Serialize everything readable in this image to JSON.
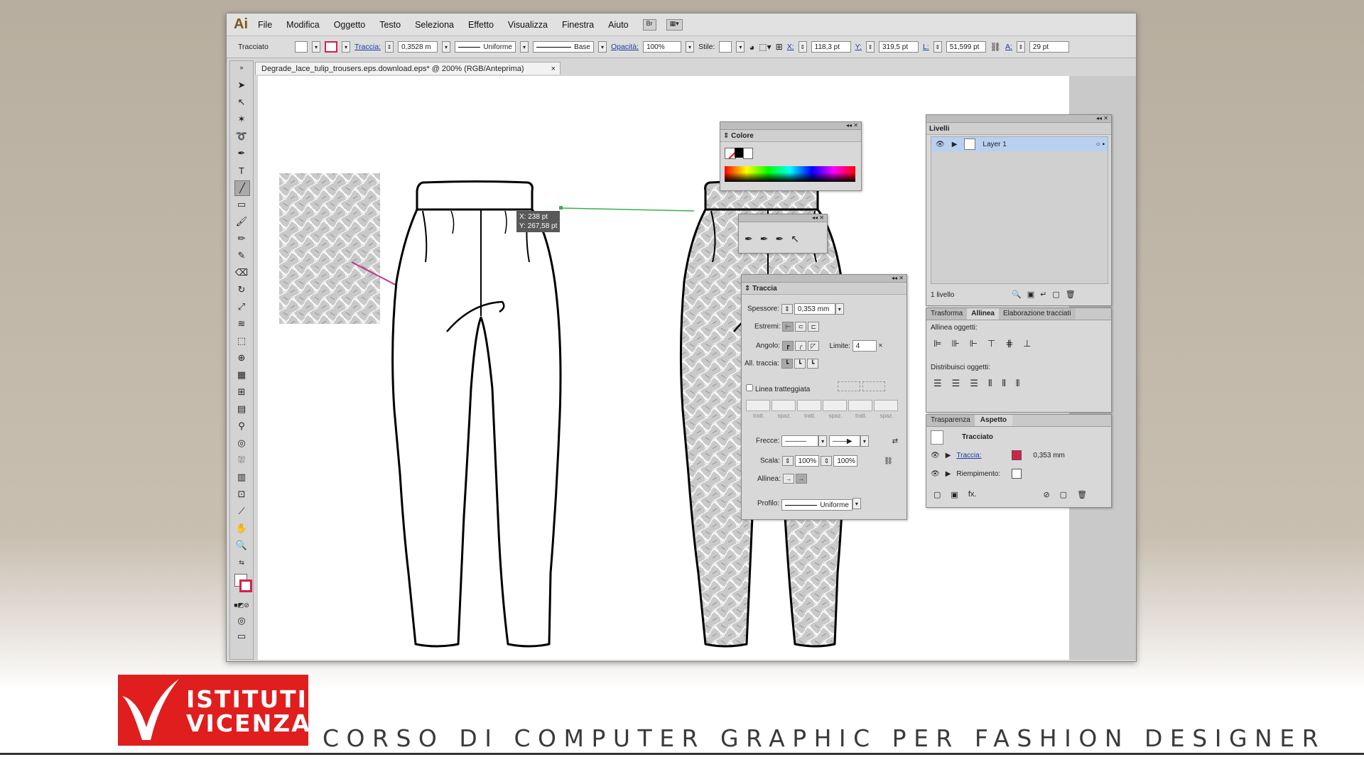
{
  "menubar": {
    "logo": "Ai",
    "items": [
      "File",
      "Modifica",
      "Oggetto",
      "Testo",
      "Seleziona",
      "Effetto",
      "Visualizza",
      "Finestra",
      "Aiuto"
    ],
    "bridge": "Br"
  },
  "control": {
    "mode": "Tracciato",
    "stroke_label": "Traccia:",
    "stroke_value": "0,3528 m",
    "profile": "Uniforme",
    "brush": "Base",
    "opacity_label": "Opacità:",
    "opacity_value": "100%",
    "style_label": "Stile:",
    "x_label": "X:",
    "x_value": "118,3 pt",
    "y_label": "Y:",
    "y_value": "319,5 pt",
    "w_label": "L:",
    "w_value": "51,599 pt",
    "h_label": "A:",
    "h_value": "29 pt"
  },
  "document": {
    "tab": "Degrade_lace_tulip_trousers.eps.download.eps* @ 200% (RGB/Anteprima)",
    "close": "×",
    "tooltip_x": "X: 238 pt",
    "tooltip_y": "Y: 267,58 pt"
  },
  "colore": {
    "title": "Colore"
  },
  "traccia": {
    "title": "Traccia",
    "spessore_label": "Spessore:",
    "spessore_value": "0,353 mm",
    "estremi_label": "Estremi:",
    "angolo_label": "Angolo:",
    "limite_label": "Limite:",
    "limite_value": "4",
    "allinea_traccia_label": "All. traccia:",
    "dashed_label": "Linea tratteggiata",
    "dash_labels": [
      "tratt.",
      "spaz.",
      "tratt.",
      "spaz.",
      "tratt.",
      "spaz."
    ],
    "frecce_label": "Frecce:",
    "scala_label": "Scala:",
    "scala_1": "100%",
    "scala_2": "100%",
    "allinea_label": "Allinea:",
    "profilo_label": "Profilo:",
    "profilo_value": "Uniforme"
  },
  "livelli": {
    "title": "Livelli",
    "layer": "Layer 1",
    "count": "1 livello"
  },
  "allinea": {
    "tabs": [
      "Trasforma",
      "Allinea",
      "Elaborazione tracciati"
    ],
    "align_label": "Allinea oggetti:",
    "distribute_label": "Distribuisci oggetti:"
  },
  "aspetto": {
    "tabs": [
      "Trasparenza",
      "Aspetto"
    ],
    "heading": "Tracciato",
    "stroke_label": "Traccia:",
    "stroke_value": "0,353 mm",
    "fill_label": "Riempimento:",
    "fx": "fx."
  },
  "footer": {
    "logo_line1": "ISTITUTI",
    "logo_line2": "VICENZA",
    "course": "CORSO DI COMPUTER GRAPHIC PER FASHION DESIGNER"
  },
  "colors": {
    "accent": "#e01e1e",
    "stroke_swatch": "#d4204a",
    "selection": "#2a7de1"
  }
}
